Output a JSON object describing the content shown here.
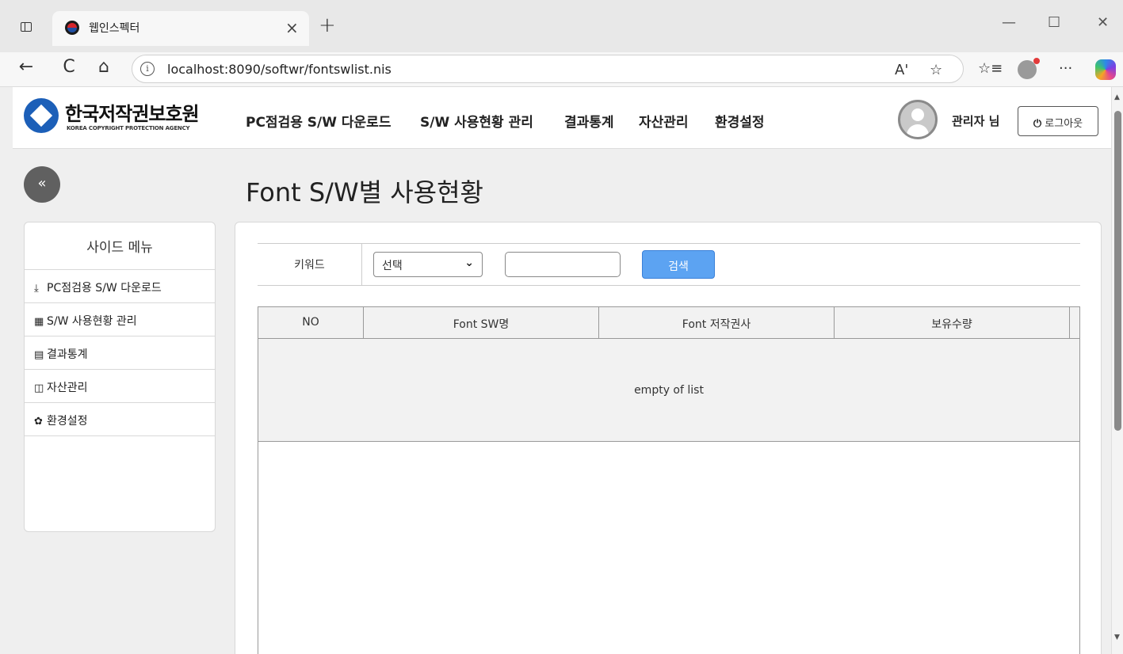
{
  "browser": {
    "tab_title": "웹인스펙터",
    "tab_close": "×",
    "new_tab": "+",
    "url": "localhost:8090/softwr/fontswlist.nis",
    "window_controls": [
      "—",
      "☐",
      "✕"
    ],
    "nav_icons": [
      "←",
      "C",
      "⌂"
    ],
    "omni_icons": [
      "A'",
      "☆"
    ],
    "toolbar_icons": [
      "☆≡",
      "···"
    ]
  },
  "header": {
    "logo_text": "한국저작권보호원",
    "logo_sub": "KOREA COPYRIGHT PROTECTION AGENCY",
    "nav": [
      "PC점검용 S/W 다운로드",
      "S/W 사용현황 관리",
      "결과통계",
      "자산관리",
      "환경설정"
    ],
    "user_name": "관리자 님",
    "logout_icon": "⏻",
    "logout_label": "로그아웃"
  },
  "collapse_icon": "«",
  "page_title": "Font S/W별 사용현황",
  "sidebar": {
    "title": "사이드 메뉴",
    "items": [
      {
        "icon": "⤓",
        "label": "PC점검용 S/W 다운로드"
      },
      {
        "icon": "▦",
        "label": "S/W 사용현황 관리"
      },
      {
        "icon": "▤",
        "label": "결과통계"
      },
      {
        "icon": "◫",
        "label": "자산관리"
      },
      {
        "icon": "✿",
        "label": "환경설정"
      }
    ]
  },
  "search": {
    "label": "키워드",
    "select_value": "선택",
    "select_chevron": "⌄",
    "input_value": "",
    "button_label": "검색"
  },
  "table": {
    "columns": [
      "NO",
      "Font SW명",
      "Font 저작권사",
      "보유수량"
    ],
    "empty_text": "empty of list"
  },
  "scrollbar": {
    "up": "▲",
    "down": "▼"
  }
}
